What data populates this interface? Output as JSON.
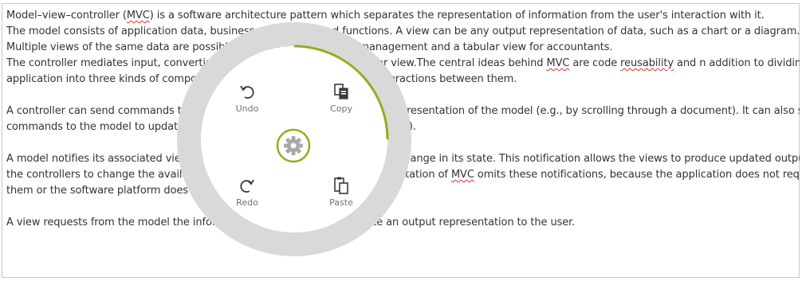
{
  "document": {
    "paragraphs": [
      {
        "lines": [
          [
            {
              "t": "Model–view–controller ("
            },
            {
              "t": "MVC",
              "u": true
            },
            {
              "t": ") is a software architecture pattern which separates the representation of information from the user's interaction with it."
            }
          ],
          [
            {
              "t": "The model consists of application data, business rules, logic, and functions. A view can be any output representation of data, such as a chart or a diagram."
            }
          ],
          [
            {
              "t": "Multiple views of the same data are possible, such as a bar chart for management and a tabular view for accountants."
            }
          ],
          [
            {
              "t": "The controller mediates input, converting it to commands for the model or view.The central ideas behind "
            },
            {
              "t": "MVC",
              "u": true
            },
            {
              "t": " are code "
            },
            {
              "t": "reusability",
              "u": true
            },
            {
              "t": " and n addition to dividing the"
            }
          ],
          [
            {
              "t": "application into three kinds of components, the MVC design defines the interactions between them."
            }
          ]
        ]
      },
      {
        "lines": [
          [
            {
              "t": "A controller can send commands to its associated view to change the view's presentation of the model (e.g., by scrolling through a document). It can also send"
            }
          ],
          [
            {
              "t": "commands to the model to update the model's state (e.g., editing a document)."
            }
          ]
        ]
      },
      {
        "lines": [
          [
            {
              "t": "A model notifies its associated views and controllers when there has been a change in its state. This notification allows the views to produce updated output, and"
            }
          ],
          [
            {
              "t": "the controllers to change the available set of commands. A passive implementation of "
            },
            {
              "t": "MVC",
              "u": true
            },
            {
              "t": " omits these notifications, because the application does not require"
            }
          ],
          [
            {
              "t": "them or the software platform does not support them."
            }
          ]
        ]
      },
      {
        "lines": [
          [
            {
              "t": "A view requests from the model the information that it needs to generate an output representation to the user."
            }
          ]
        ]
      }
    ]
  },
  "radial_menu": {
    "items": {
      "undo": {
        "label": "Undo",
        "icon": "undo-icon"
      },
      "copy": {
        "label": "Copy",
        "icon": "copy-icon"
      },
      "redo": {
        "label": "Redo",
        "icon": "redo-icon"
      },
      "paste": {
        "label": "Paste",
        "icon": "paste-icon"
      }
    },
    "center": {
      "icon": "gear-icon"
    },
    "colors": {
      "ring": "#d9d9d9",
      "inner": "#ffffff",
      "accent": "#8faf1f",
      "icon": "#3a3a3a",
      "gear": "#a8a8a8"
    }
  }
}
